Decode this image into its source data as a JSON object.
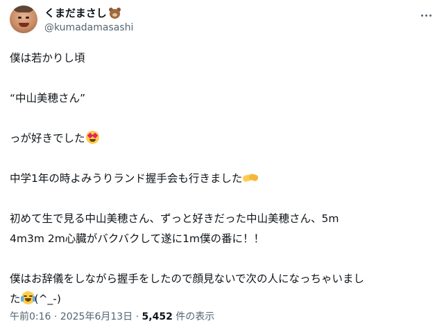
{
  "user": {
    "display_name": "くまだまさし",
    "name_emoji": "bear-face",
    "handle": "@kumadamasashi"
  },
  "tweet": {
    "line1": "僕は若かりし頃",
    "line2": "“中山美穂さん”",
    "line3": "っが好きでした",
    "line3_emoji": "smiling-face-with-heart-eyes",
    "line4": "中学1年の時よみうりランド握手会も行きました",
    "line4_emoji": "handshake",
    "line5": "初めて生で見る中山美穂さん、ずっと好きだった中山美穂さん、5m",
    "line6": "4m3m 2m心臓がバクバクして遂に1m僕の番に！！",
    "line7": "僕はお辞儀をしながら握手をしたので顔見ないで次の人になっちゃいまし",
    "line8_pre": "た",
    "line8_emoji": "face-with-tears-of-joy",
    "line8_post": "(^_-)"
  },
  "meta": {
    "time": "午前0:16",
    "sep1": " · ",
    "date": "2025年6月13日",
    "sep2": " · ",
    "views": "5,452",
    "views_suffix": " 件の表示"
  }
}
